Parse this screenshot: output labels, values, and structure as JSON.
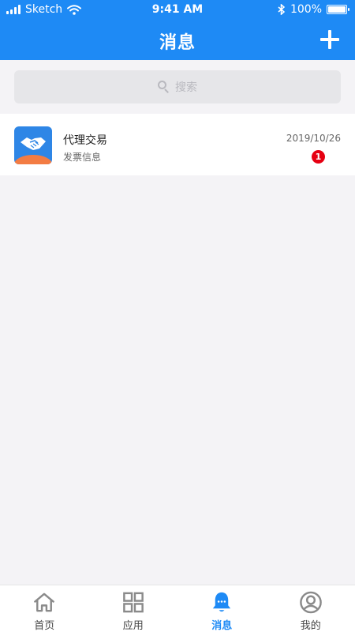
{
  "status_bar": {
    "carrier": "Sketch",
    "time": "9:41 AM",
    "battery": "100%"
  },
  "nav": {
    "title": "消息"
  },
  "search": {
    "placeholder": "搜索"
  },
  "messages": [
    {
      "name": "代理交易",
      "preview": "发票信息",
      "date": "2019/10/26",
      "unread": "1"
    }
  ],
  "tabs": [
    {
      "label": "首页",
      "icon": "home-icon",
      "active": false
    },
    {
      "label": "应用",
      "icon": "grid-icon",
      "active": false
    },
    {
      "label": "消息",
      "icon": "bell-icon",
      "active": true
    },
    {
      "label": "我的",
      "icon": "user-icon",
      "active": false
    }
  ],
  "colors": {
    "primary": "#1e8af5",
    "badge": "#e60012",
    "background": "#f4f3f6"
  }
}
